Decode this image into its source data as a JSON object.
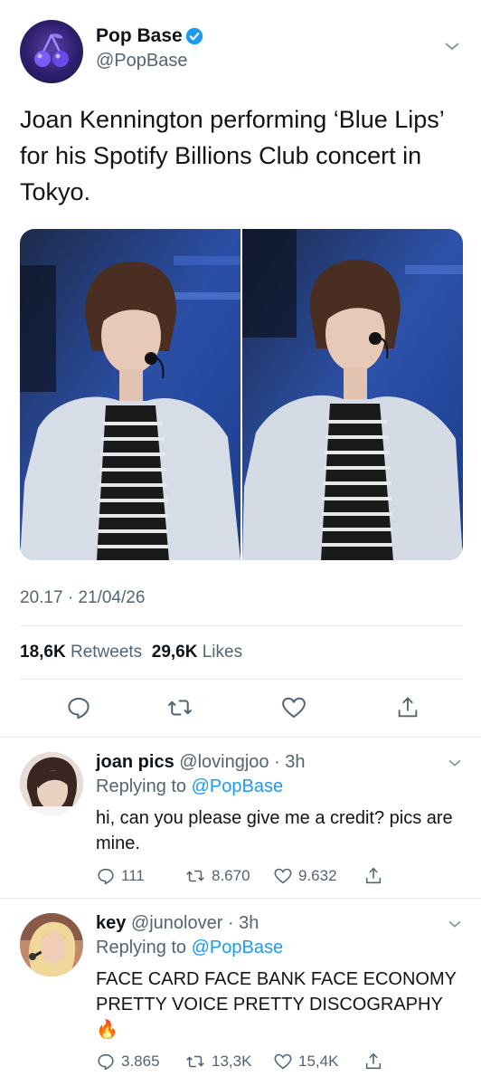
{
  "tweet": {
    "author_name": "Pop Base",
    "author_handle": "@PopBase",
    "text": "Joan Kennington performing ‘Blue Lips’ for his Spotify Billions Club concert in Tokyo.",
    "timestamp": "20.17 · 21/04/26",
    "retweets_count": "18,6K",
    "retweets_label": "Retweets",
    "likes_count": "29,6K",
    "likes_label": "Likes",
    "photo_count": 2
  },
  "replies": [
    {
      "name": "joan pics",
      "handle": "@lovingjoo",
      "time": "· 3h",
      "replying_prefix": "Replying to",
      "replying_to": "@PopBase",
      "text": "hi, can you please give me a credit? pics are mine.",
      "reply_count": "111",
      "retweet_count": "8.670",
      "like_count": "9.632"
    },
    {
      "name": "key",
      "handle": "@junolover",
      "time": "· 3h",
      "replying_prefix": "Replying to",
      "replying_to": "@PopBase",
      "text": "FACE CARD FACE BANK FACE ECONOMY PRETTY VOICE PRETTY DISCOGRAPHY",
      "emoji": "🔥",
      "reply_count": "3.865",
      "retweet_count": "13,3K",
      "like_count": "15,4K"
    }
  ],
  "colors": {
    "accent": "#1d9bf0",
    "secondary_text": "#536471",
    "primary_text": "#0f1419"
  },
  "icons": {
    "verified": "verified-badge-icon",
    "caret": "chevron-down-icon",
    "reply": "reply-icon",
    "retweet": "retweet-icon",
    "like": "heart-icon",
    "share": "share-icon"
  }
}
